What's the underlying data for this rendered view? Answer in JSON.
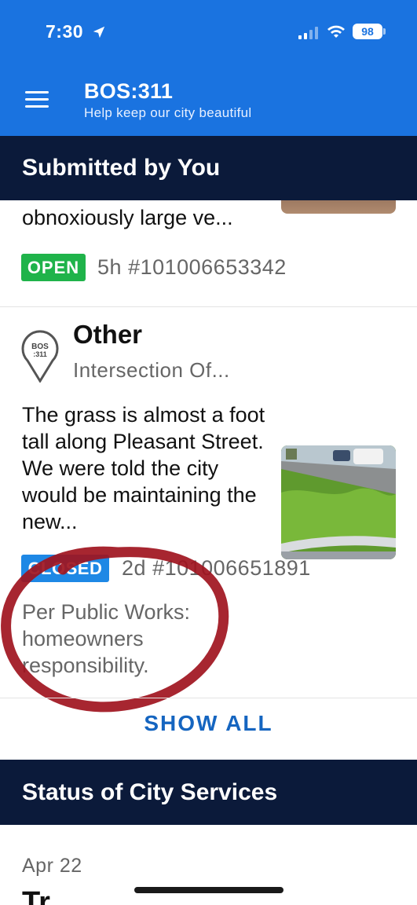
{
  "status_bar": {
    "time": "7:30",
    "battery": "98",
    "icons": [
      "location-arrow-icon",
      "signal-icon",
      "wifi-icon",
      "battery-icon"
    ]
  },
  "header": {
    "menu_icon": "hamburger-menu-icon",
    "title": "BOS:311",
    "subtitle": "Help keep our city beautiful",
    "bg_color": "#1a73e0"
  },
  "submitted_section": {
    "title": "Submitted by You",
    "reports": [
      {
        "description": "obnoxiously large ve...",
        "status": "OPEN",
        "status_color": "#1fb34a",
        "age": "5h",
        "case_number": "#101006653342"
      },
      {
        "pin_label": "BOS :311",
        "type": "Other",
        "location": "Intersection Of...",
        "description": "The grass is almost a foot tall along Pleasant Street.  We were told the city would be maintaining the new...",
        "status": "CLOSED",
        "status_color": "#1e88e5",
        "age": "2d",
        "case_number": "#101006651891",
        "response": "Per Public Works: homeowners responsibility."
      }
    ],
    "show_all_label": "SHOW ALL"
  },
  "city_services_section": {
    "title": "Status of City Services",
    "date": "Apr 22",
    "first_item_partial": "Tr"
  },
  "annotation": {
    "color": "#a0141e"
  }
}
